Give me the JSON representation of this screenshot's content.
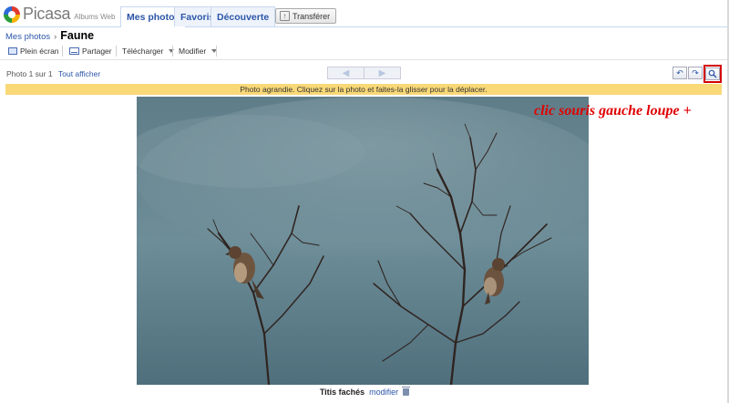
{
  "app": {
    "logo_text": "Picasa",
    "logo_sub": "Albums Web",
    "tabs": [
      {
        "label": "Mes photos",
        "active": true
      },
      {
        "label": "Favoris",
        "active": false
      },
      {
        "label": "Découverte",
        "active": false
      }
    ],
    "upload_label": "Transférer"
  },
  "breadcrumb": {
    "root": "Mes photos",
    "separator": "›",
    "title": "Faune"
  },
  "toolbar": {
    "fullscreen": "Plein écran",
    "share": "Partager",
    "download": "Télécharger",
    "modify": "Modifier"
  },
  "photo_nav": {
    "count": "Photo 1 sur 1",
    "show_all": "Tout afficher",
    "prev_icon": "arrow-left-icon",
    "next_icon": "arrow-right-icon"
  },
  "banner": {
    "text": "Photo agrandie. Cliquez sur la photo et faites-la glisser pour la déplacer.",
    "color": "#f9d877"
  },
  "annotation": {
    "text": "clic souris gauche loupe +",
    "color": "#e00000"
  },
  "photo": {
    "caption": "Titis fachés",
    "edit_label": "modifier",
    "description_icon": "photo-two-sparrows-on-branches"
  },
  "colors": {
    "link": "#2b55a8",
    "highlight_box": "#d40000"
  }
}
